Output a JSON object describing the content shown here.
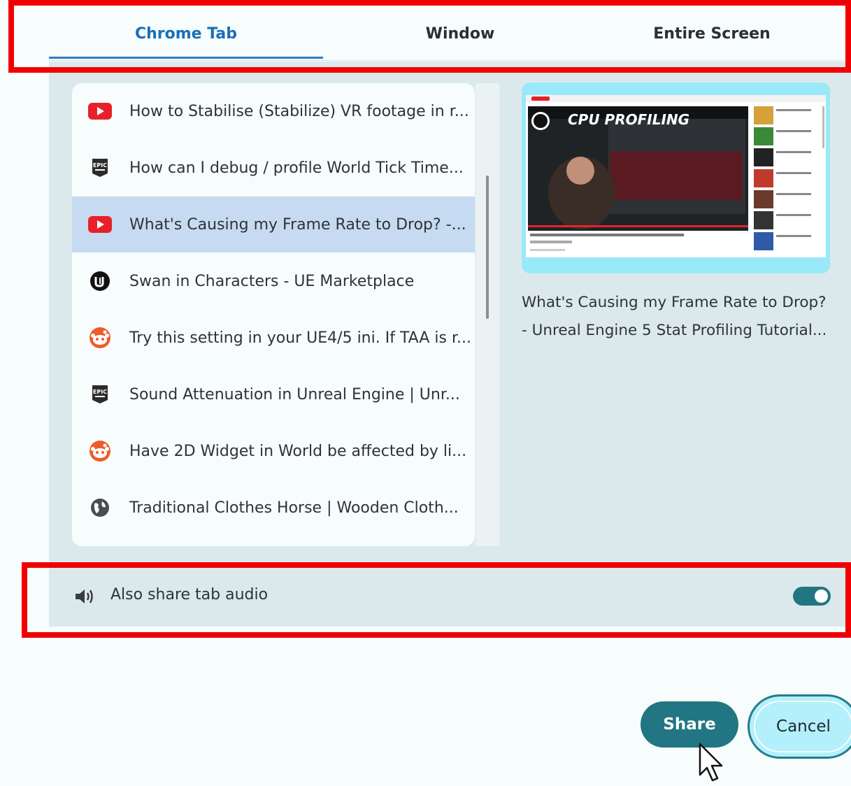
{
  "tabs": [
    {
      "label": "Chrome Tab",
      "active": true
    },
    {
      "label": "Window",
      "active": false
    },
    {
      "label": "Entire Screen",
      "active": false
    }
  ],
  "list": {
    "selected_index": 2,
    "items": [
      {
        "icon": "youtube-icon",
        "label": "How to Stabilise (Stabilize) VR footage in r..."
      },
      {
        "icon": "epic-games-icon",
        "label": "How can I debug / profile World Tick Time..."
      },
      {
        "icon": "youtube-icon",
        "label": "What's Causing my Frame Rate to Drop? -..."
      },
      {
        "icon": "unreal-engine-icon",
        "label": "Swan in Characters - UE Marketplace"
      },
      {
        "icon": "reddit-icon",
        "label": "Try this setting in your UE4/5 ini. If TAA is r..."
      },
      {
        "icon": "epic-games-icon",
        "label": "Sound Attenuation in Unreal Engine | Unr..."
      },
      {
        "icon": "reddit-icon",
        "label": "Have 2D Widget in World be affected by li..."
      },
      {
        "icon": "globe-icon",
        "label": "Traditional Clothes Horse | Wooden Cloth..."
      }
    ]
  },
  "preview": {
    "thumbnail_headline": "CPU PROFILING",
    "title_line1": "What's Causing my Frame Rate to Drop?",
    "title_line2": "- Unreal Engine 5 Stat Profiling Tutorial..."
  },
  "audio": {
    "label": "Also share tab audio",
    "enabled": true
  },
  "buttons": {
    "share": "Share",
    "cancel": "Cancel"
  },
  "colors": {
    "accent": "#1a6fb8",
    "teal": "#227582",
    "selected_row": "#c6dbf1",
    "highlight_box": "#f00000"
  }
}
